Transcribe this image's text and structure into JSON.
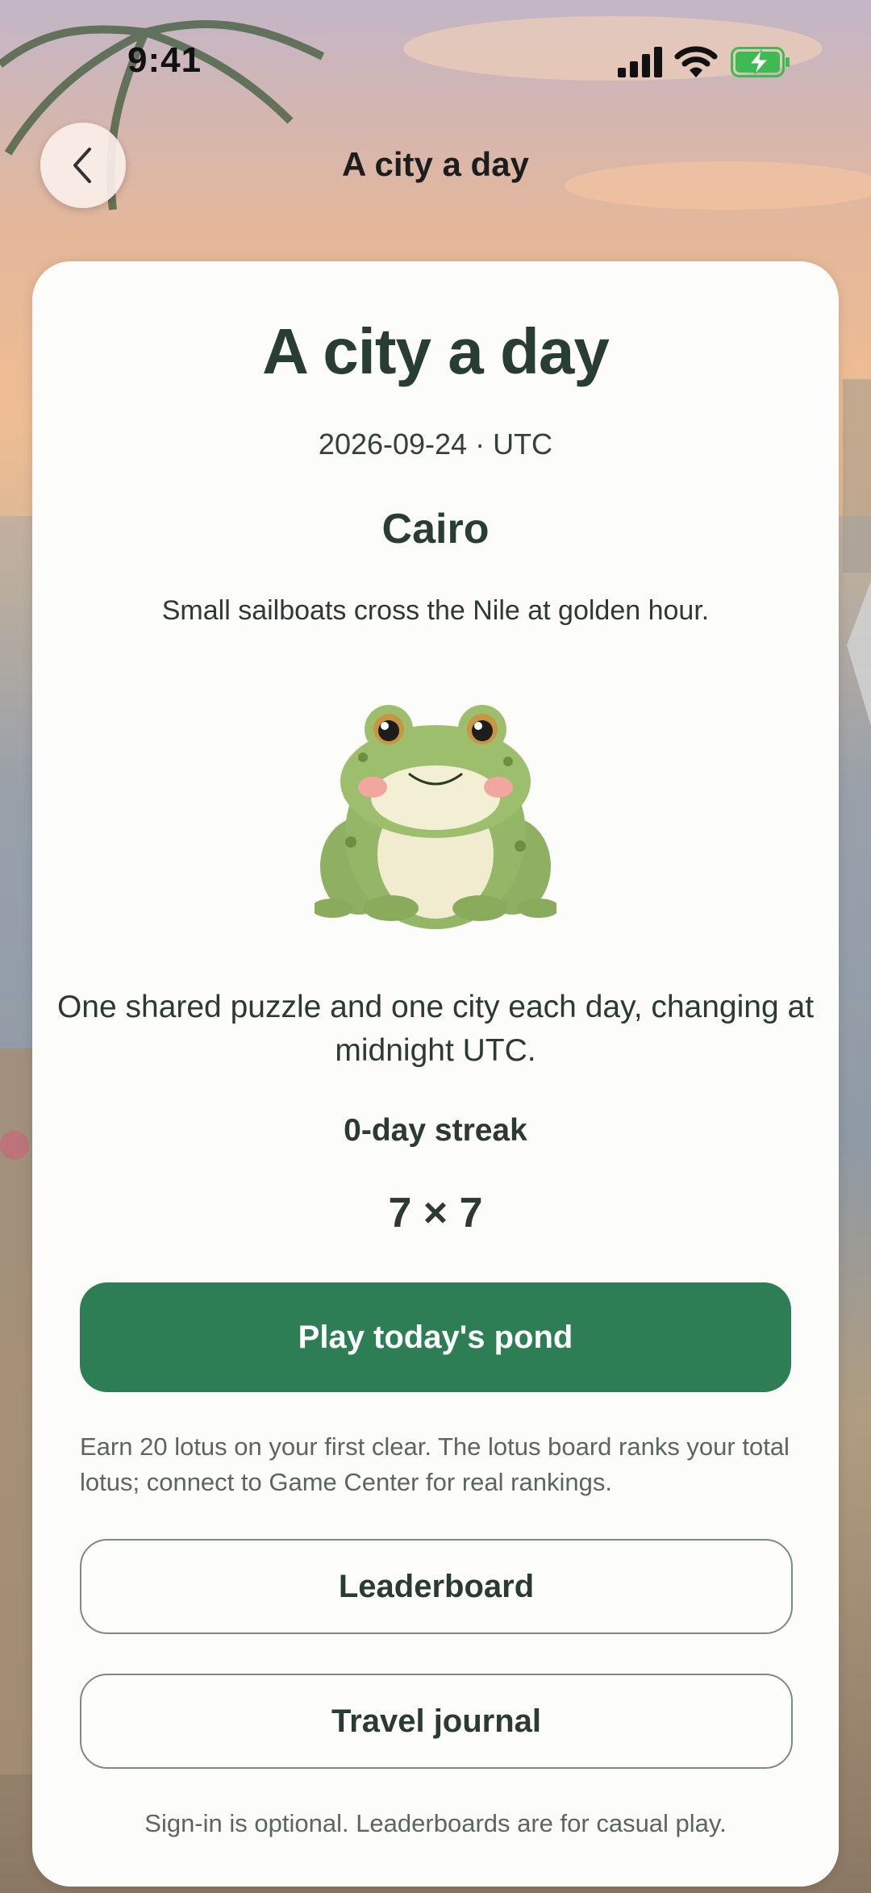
{
  "status_bar": {
    "time": "9:41"
  },
  "nav": {
    "title": "A city a day"
  },
  "card": {
    "title": "A city a day",
    "date": "2026-09-24 · UTC",
    "city": "Cairo",
    "caption": "Small sailboats cross the Nile at golden hour.",
    "description": "One shared puzzle and one city each day, changing at midnight UTC.",
    "streak": "0-day streak",
    "grid_size": "7 × 7",
    "play_label": "Play today's pond",
    "reward_note": "Earn 20 lotus on your first clear. The lotus board ranks your total lotus; connect to Game Center for real rankings.",
    "leaderboard_label": "Leaderboard",
    "journal_label": "Travel journal",
    "footer": "Sign-in is optional. Leaderboards are for casual play."
  },
  "colors": {
    "accent": "#2d7d55",
    "card": "#fcfcfa",
    "text": "#283d33",
    "battery": "#3dbb52"
  },
  "icons": [
    "chevron-left-icon",
    "cellular-signal-icon",
    "wifi-icon",
    "battery-charging-icon",
    "frog-mascot"
  ]
}
